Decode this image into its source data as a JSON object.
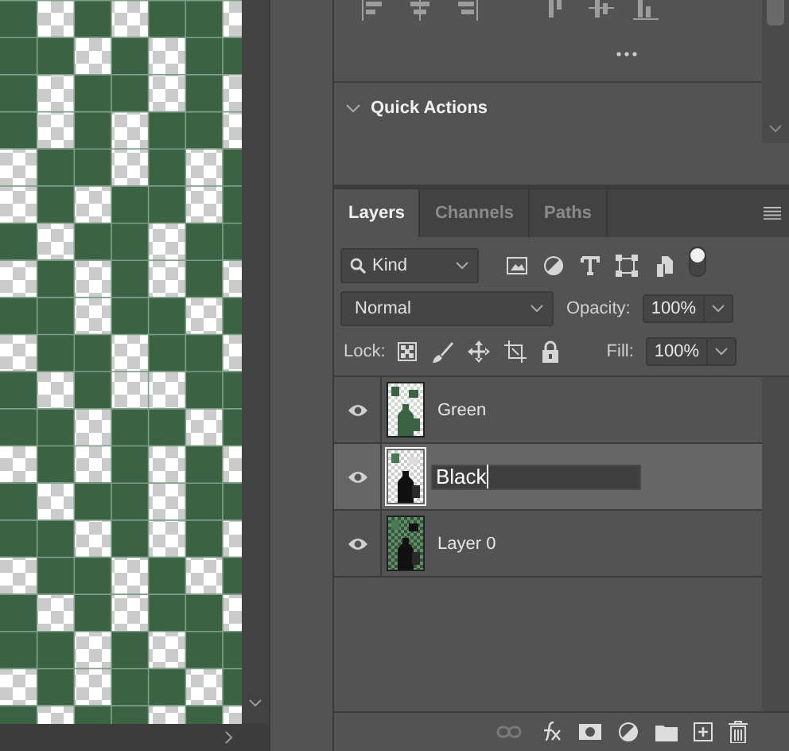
{
  "quick_actions": {
    "title": "Quick Actions",
    "expanded": true
  },
  "tabs": [
    {
      "label": "Layers",
      "selected": true
    },
    {
      "label": "Channels",
      "selected": false
    },
    {
      "label": "Paths",
      "selected": false
    }
  ],
  "filter": {
    "value": "Kind",
    "on": true
  },
  "blend_mode": {
    "value": "Normal"
  },
  "opacity": {
    "label": "Opacity:",
    "value": "100%"
  },
  "lock": {
    "label": "Lock:"
  },
  "fill": {
    "label": "Fill:",
    "value": "100%"
  },
  "layers": [
    {
      "name": "Green",
      "kind": "green",
      "visible": true,
      "selected": false,
      "editing": false
    },
    {
      "name": "Black",
      "kind": "black",
      "visible": true,
      "selected": true,
      "editing": true
    },
    {
      "name": "Layer 0",
      "kind": "full",
      "visible": true,
      "selected": false,
      "editing": false
    }
  ]
}
